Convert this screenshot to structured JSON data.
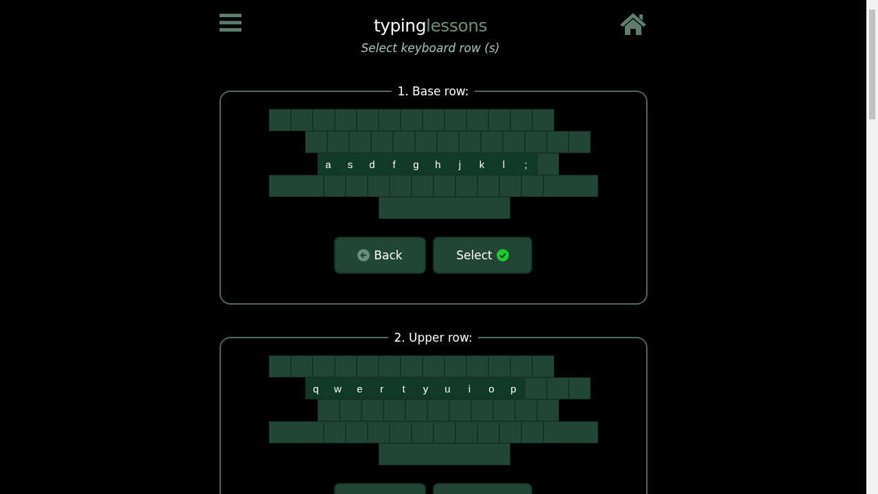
{
  "header": {
    "logo": {
      "first": "typing",
      "second": "lessons"
    },
    "subtitle": "Select keyboard row (s)"
  },
  "sections": [
    {
      "title": "1. Base row:",
      "rows": [
        [
          {
            "kind": "key",
            "active": false
          },
          {
            "kind": "key",
            "active": false
          },
          {
            "kind": "key",
            "active": false
          },
          {
            "kind": "key",
            "active": false
          },
          {
            "kind": "key",
            "active": false
          },
          {
            "kind": "key",
            "active": false
          },
          {
            "kind": "key",
            "active": false
          },
          {
            "kind": "key",
            "active": false
          },
          {
            "kind": "key",
            "active": false
          },
          {
            "kind": "key",
            "active": false
          },
          {
            "kind": "key",
            "active": false
          },
          {
            "kind": "key",
            "active": false
          },
          {
            "kind": "key",
            "active": false
          }
        ],
        [
          {
            "kind": "key",
            "active": false
          },
          {
            "kind": "key",
            "active": false
          },
          {
            "kind": "key",
            "active": false
          },
          {
            "kind": "key",
            "active": false
          },
          {
            "kind": "key",
            "active": false
          },
          {
            "kind": "key",
            "active": false
          },
          {
            "kind": "key",
            "active": false
          },
          {
            "kind": "key",
            "active": false
          },
          {
            "kind": "key",
            "active": false
          },
          {
            "kind": "key",
            "active": false
          },
          {
            "kind": "key",
            "active": false
          },
          {
            "kind": "key",
            "active": false
          },
          {
            "kind": "key",
            "active": false
          }
        ],
        [
          {
            "kind": "key",
            "label": "a",
            "active": true
          },
          {
            "kind": "key",
            "label": "s",
            "active": true
          },
          {
            "kind": "key",
            "label": "d",
            "active": true
          },
          {
            "kind": "key",
            "label": "f",
            "active": true
          },
          {
            "kind": "key",
            "label": "g",
            "active": true
          },
          {
            "kind": "key",
            "label": "h",
            "active": true
          },
          {
            "kind": "key",
            "label": "j",
            "active": true
          },
          {
            "kind": "key",
            "label": "k",
            "active": true
          },
          {
            "kind": "key",
            "label": "l",
            "active": true
          },
          {
            "kind": "key",
            "label": ";",
            "active": true
          },
          {
            "kind": "key",
            "active": false
          }
        ],
        [
          {
            "kind": "wide",
            "active": false
          },
          {
            "kind": "key",
            "active": false
          },
          {
            "kind": "key",
            "active": false
          },
          {
            "kind": "key",
            "active": false
          },
          {
            "kind": "key",
            "active": false
          },
          {
            "kind": "key",
            "active": false
          },
          {
            "kind": "key",
            "active": false
          },
          {
            "kind": "key",
            "active": false
          },
          {
            "kind": "key",
            "active": false
          },
          {
            "kind": "key",
            "active": false
          },
          {
            "kind": "key",
            "active": false
          },
          {
            "kind": "wide",
            "active": false
          }
        ],
        [
          {
            "kind": "space",
            "active": false
          }
        ]
      ],
      "buttons": [
        {
          "kind": "back",
          "label": "Back"
        },
        {
          "kind": "select",
          "label": "Select"
        }
      ]
    },
    {
      "title": "2. Upper row:",
      "rows": [
        [
          {
            "kind": "key",
            "active": false
          },
          {
            "kind": "key",
            "active": false
          },
          {
            "kind": "key",
            "active": false
          },
          {
            "kind": "key",
            "active": false
          },
          {
            "kind": "key",
            "active": false
          },
          {
            "kind": "key",
            "active": false
          },
          {
            "kind": "key",
            "active": false
          },
          {
            "kind": "key",
            "active": false
          },
          {
            "kind": "key",
            "active": false
          },
          {
            "kind": "key",
            "active": false
          },
          {
            "kind": "key",
            "active": false
          },
          {
            "kind": "key",
            "active": false
          },
          {
            "kind": "key",
            "active": false
          }
        ],
        [
          {
            "kind": "key",
            "label": "q",
            "active": true
          },
          {
            "kind": "key",
            "label": "w",
            "active": true
          },
          {
            "kind": "key",
            "label": "e",
            "active": true
          },
          {
            "kind": "key",
            "label": "r",
            "active": true
          },
          {
            "kind": "key",
            "label": "t",
            "active": true
          },
          {
            "kind": "key",
            "label": "y",
            "active": true
          },
          {
            "kind": "key",
            "label": "u",
            "active": true
          },
          {
            "kind": "key",
            "label": "i",
            "active": true
          },
          {
            "kind": "key",
            "label": "o",
            "active": true
          },
          {
            "kind": "key",
            "label": "p",
            "active": true
          },
          {
            "kind": "key",
            "active": false
          },
          {
            "kind": "key",
            "active": false
          },
          {
            "kind": "key",
            "active": false
          }
        ],
        [
          {
            "kind": "key",
            "active": false
          },
          {
            "kind": "key",
            "active": false
          },
          {
            "kind": "key",
            "active": false
          },
          {
            "kind": "key",
            "active": false
          },
          {
            "kind": "key",
            "active": false
          },
          {
            "kind": "key",
            "active": false
          },
          {
            "kind": "key",
            "active": false
          },
          {
            "kind": "key",
            "active": false
          },
          {
            "kind": "key",
            "active": false
          },
          {
            "kind": "key",
            "active": false
          },
          {
            "kind": "key",
            "active": false
          }
        ],
        [
          {
            "kind": "wide",
            "active": false
          },
          {
            "kind": "key",
            "active": false
          },
          {
            "kind": "key",
            "active": false
          },
          {
            "kind": "key",
            "active": false
          },
          {
            "kind": "key",
            "active": false
          },
          {
            "kind": "key",
            "active": false
          },
          {
            "kind": "key",
            "active": false
          },
          {
            "kind": "key",
            "active": false
          },
          {
            "kind": "key",
            "active": false
          },
          {
            "kind": "key",
            "active": false
          },
          {
            "kind": "key",
            "active": false
          },
          {
            "kind": "wide",
            "active": false
          }
        ],
        [
          {
            "kind": "space",
            "active": false
          }
        ]
      ],
      "buttons": [
        {
          "kind": "back"
        },
        {
          "kind": "select"
        }
      ]
    }
  ]
}
